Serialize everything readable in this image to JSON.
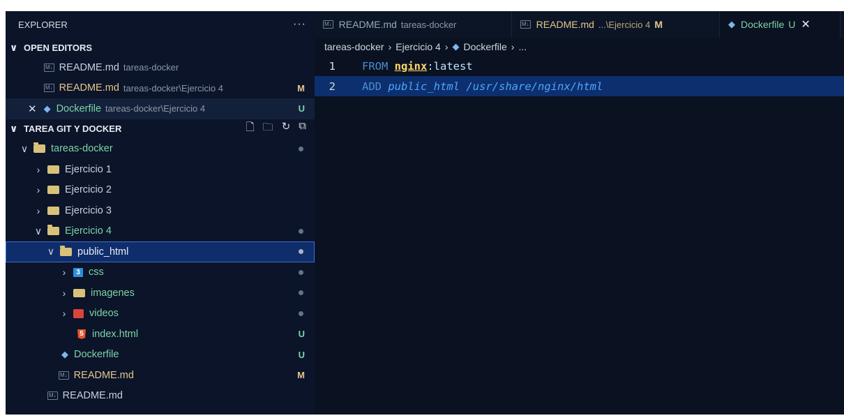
{
  "explorer": {
    "title": "EXPLORER",
    "more": "···",
    "open_editors": {
      "label": "OPEN EDITORS",
      "items": [
        {
          "name": "README.md",
          "desc": "tareas-docker",
          "badge": ""
        },
        {
          "name": "README.md",
          "desc": "tareas-docker\\Ejercicio 4",
          "badge": "M"
        },
        {
          "name": "Dockerfile",
          "desc": "tareas-docker\\Ejercicio 4",
          "badge": "U"
        }
      ]
    },
    "workspace": {
      "label": "TAREA GIT Y DOCKER",
      "tree": {
        "tareas_docker": "tareas-docker",
        "ej1": "Ejercicio 1",
        "ej2": "Ejercicio 2",
        "ej3": "Ejercicio 3",
        "ej4": "Ejercicio 4",
        "public_html": "public_html",
        "css": "css",
        "imagenes": "imagenes",
        "videos": "videos",
        "index": "index.html",
        "index_badge": "U",
        "dockerfile": "Dockerfile",
        "dockerfile_badge": "U",
        "readme_inner": "README.md",
        "readme_inner_badge": "M",
        "readme_root": "README.md"
      }
    }
  },
  "tabs": [
    {
      "name": "README.md",
      "desc": "tareas-docker"
    },
    {
      "name": "README.md",
      "desc": "...\\Ejercicio 4",
      "badge": "M"
    },
    {
      "name": "Dockerfile",
      "badge": "U",
      "close": "✕"
    }
  ],
  "breadcrumb": [
    "tareas-docker",
    "Ejercicio 4",
    "Dockerfile",
    "..."
  ],
  "code": {
    "l1": {
      "num": "1",
      "kw": "FROM",
      "image": "nginx",
      "rest": ":latest"
    },
    "l2": {
      "num": "2",
      "kw": "ADD",
      "src": "public_html",
      "dst": "/usr/share/nginx/html"
    }
  }
}
